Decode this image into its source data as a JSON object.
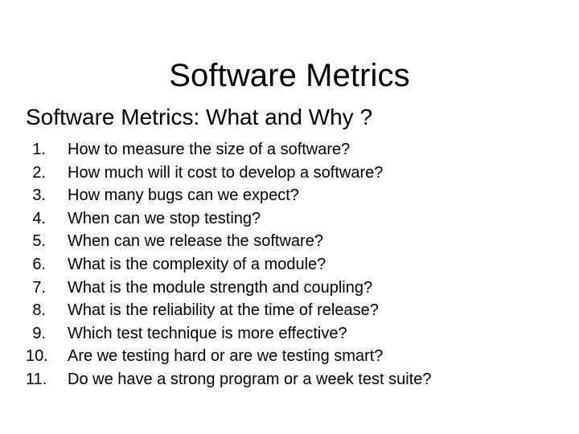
{
  "slide": {
    "title": "Software Metrics",
    "section_heading": "Software Metrics: What and Why ?",
    "background_color": "#ffffff",
    "text_color": "#000000",
    "list_items": [
      {
        "number": "1.",
        "text": "How to measure the size of a software?"
      },
      {
        "number": "2.",
        "text": "How much will it cost to develop a software?"
      },
      {
        "number": "3.",
        "text": "How many bugs can we expect?"
      },
      {
        "number": "4.",
        "text": "When can we stop testing?"
      },
      {
        "number": "5.",
        "text": "When can we release the software?"
      },
      {
        "number": "6.",
        "text": "What is the complexity of a module?"
      },
      {
        "number": "7.",
        "text": "What is the module strength and coupling?"
      },
      {
        "number": "8.",
        "text": "What is the reliability at the time of release?"
      },
      {
        "number": "9.",
        "text": "Which test technique is more effective?"
      },
      {
        "number": "10.",
        "text": "Are we testing hard or are we testing smart?"
      },
      {
        "number": "11.",
        "text": "Do we have a strong program or a week test suite?"
      }
    ]
  }
}
